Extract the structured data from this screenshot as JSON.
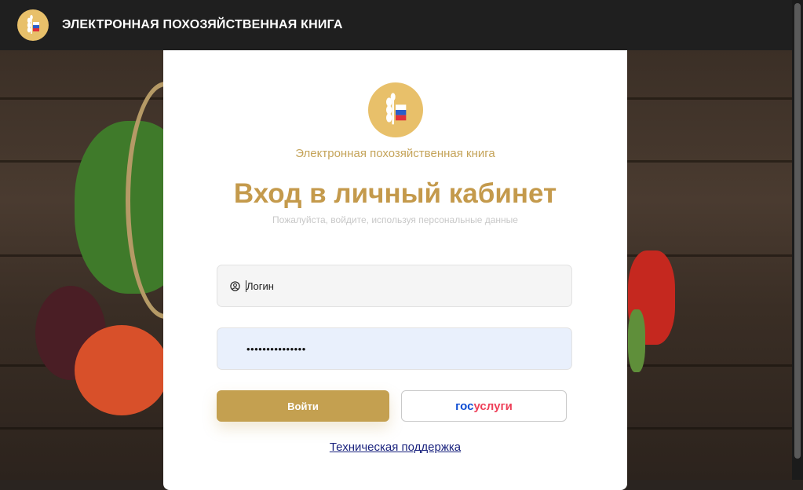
{
  "header": {
    "title": "ЭЛЕКТРОННАЯ ПОХОЗЯЙСТВЕННАЯ КНИГА",
    "logo_icon": "wheat-flag-icon"
  },
  "login_card": {
    "subtitle": "Электронная похозяйственная книга",
    "title": "Вход в личный кабинет",
    "hint": "Пожалуйста, войдите, используя персональные данные",
    "login_field": {
      "icon": "user-circle-icon",
      "placeholder": "Логин",
      "value": ""
    },
    "password_field": {
      "value": "•••••••••••••••"
    },
    "login_button": "Войти",
    "gosuslugi_button": {
      "part1": "гос",
      "part2": "услуги"
    },
    "support_link": "Техническая поддержка"
  },
  "colors": {
    "accent_gold": "#c4a050",
    "title_gold": "#c49a4c",
    "logo_gold": "#e8c06a",
    "topbar": "#1f1f1f",
    "gos_blue": "#0d4cd3",
    "gos_red": "#ee3f58",
    "link": "#1a237e"
  }
}
